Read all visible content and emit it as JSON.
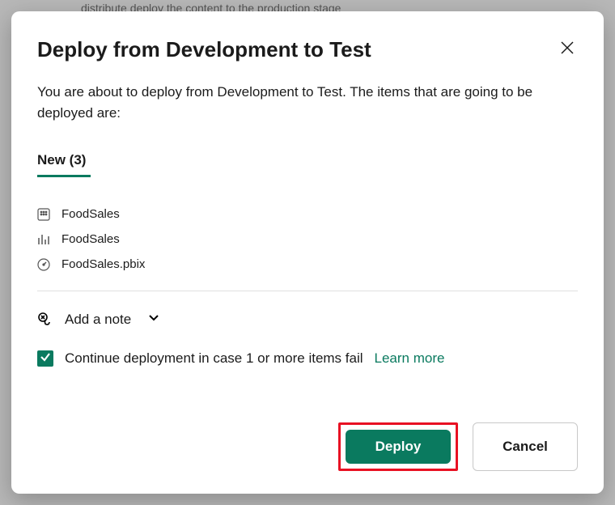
{
  "backdrop": "distribute  deploy the content to the production stage",
  "modal": {
    "title": "Deploy from Development to Test",
    "description": "You are about to deploy from Development to Test. The items that are going to be deployed are:",
    "tab_label": "New (3)",
    "items": [
      {
        "icon": "table",
        "name": "FoodSales"
      },
      {
        "icon": "chart",
        "name": "FoodSales"
      },
      {
        "icon": "gauge",
        "name": "FoodSales.pbix"
      }
    ],
    "add_note_label": "Add a note",
    "continue_label": "Continue deployment in case 1 or more items fail",
    "learn_more_label": "Learn more",
    "deploy_label": "Deploy",
    "cancel_label": "Cancel"
  }
}
